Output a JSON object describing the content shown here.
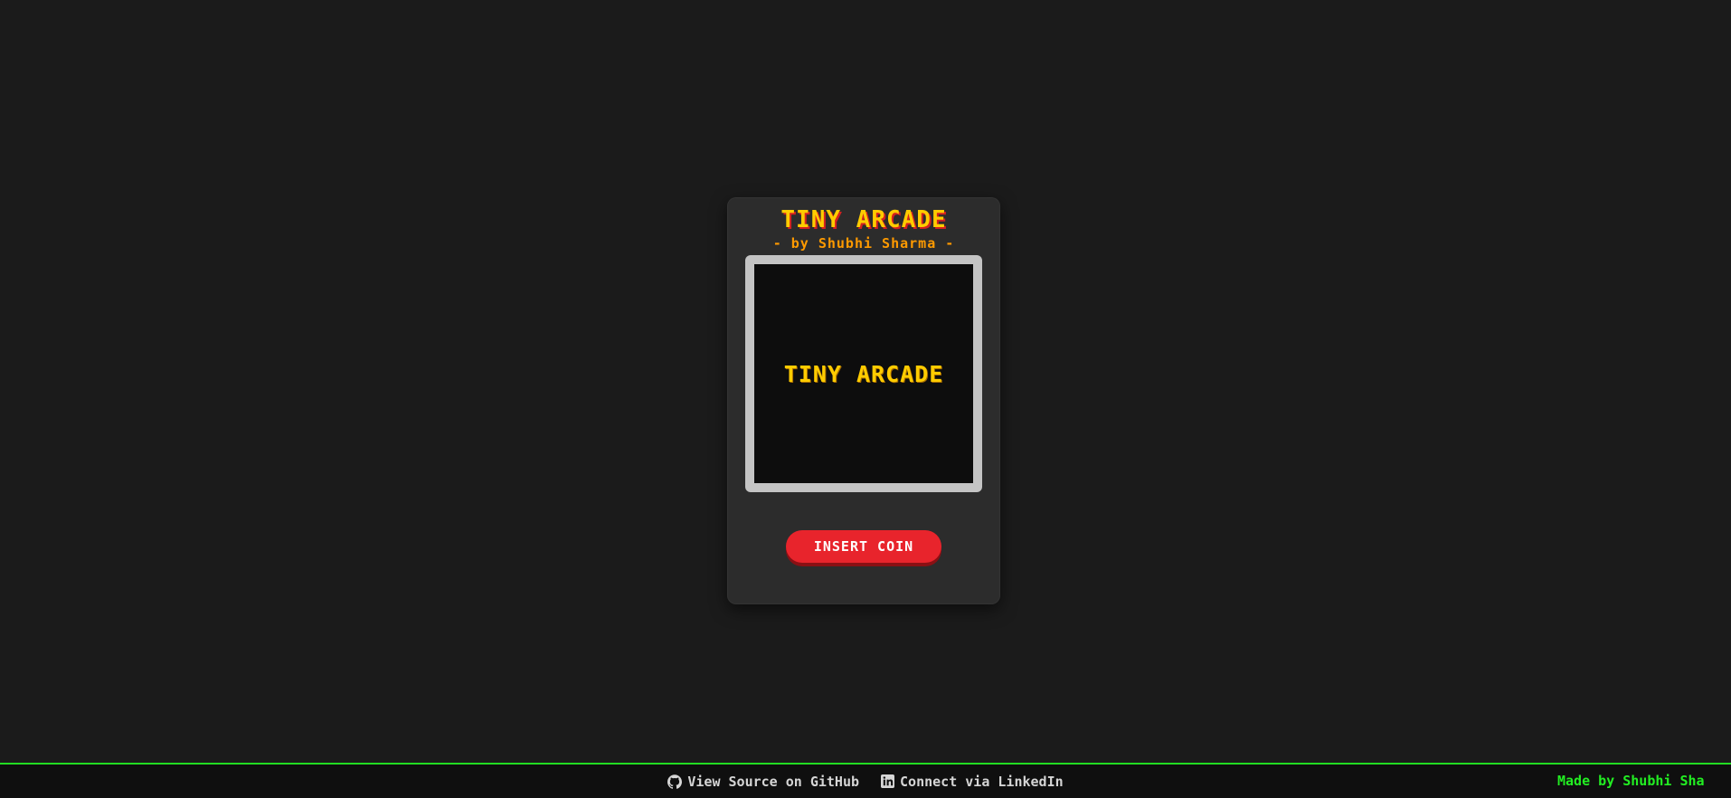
{
  "cabinet": {
    "title": "TINY ARCADE",
    "subtitle": "- by Shubhi Sharma -",
    "screen_text": "TINY ARCADE",
    "insert_coin_label": "INSERT COIN"
  },
  "footer": {
    "github_label": "View Source on GitHub",
    "github_icon": "github-icon",
    "linkedin_label": "Connect via LinkedIn",
    "linkedin_icon": "linkedin-icon",
    "marquee_text": "Made by Shubhi Sha"
  },
  "colors": {
    "background": "#1b1b1b",
    "accent_yellow": "#ffcc00",
    "button_red": "#e8242c",
    "footer_green": "#22dd22"
  }
}
